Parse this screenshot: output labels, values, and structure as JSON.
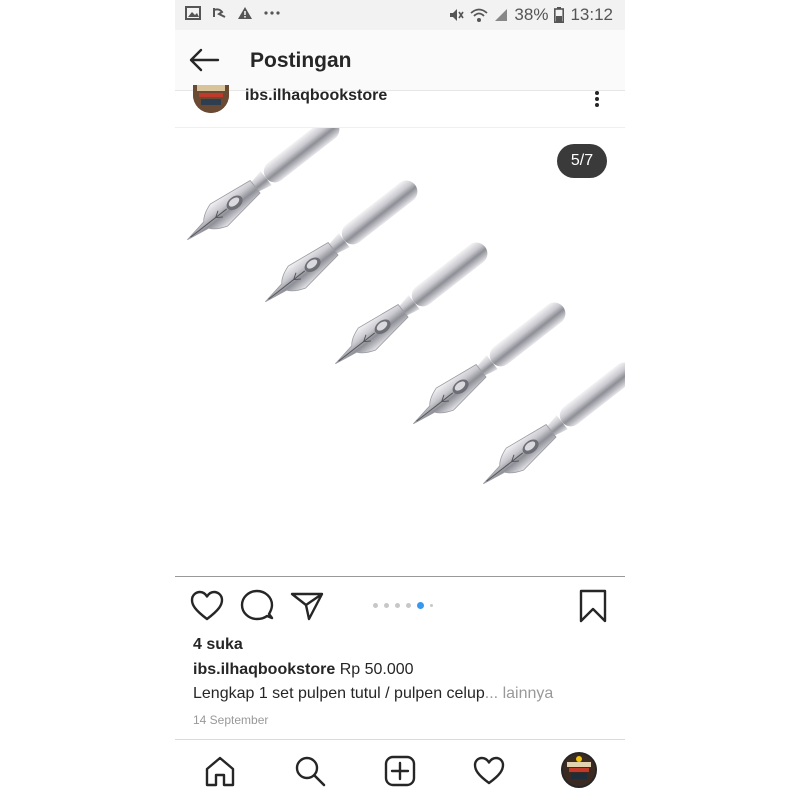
{
  "status_bar": {
    "battery_percent": "38%",
    "time": "13:12",
    "left_icons": [
      "gallery-icon",
      "refresh-icon",
      "warning-icon",
      "more-dots-icon"
    ],
    "right_icons": [
      "mute-icon",
      "wifi-icon",
      "signal-icon",
      "battery-icon"
    ]
  },
  "header": {
    "title": "Postingan"
  },
  "post": {
    "username": "ibs.ilhaqbookstore",
    "image_counter": "5/7",
    "carousel": {
      "total": 7,
      "current": 5
    },
    "likes": "4 suka",
    "caption_user": "ibs.ilhaqbookstore",
    "caption_text": " Rp 50.000",
    "caption_line2": "Lengkap 1 set pulpen tutul / pulpen celup",
    "more_label": "... lainnya",
    "date": "14 September"
  },
  "colors": {
    "accent_dot": "#3897f0",
    "counter_bg": "#3a3a3a"
  }
}
